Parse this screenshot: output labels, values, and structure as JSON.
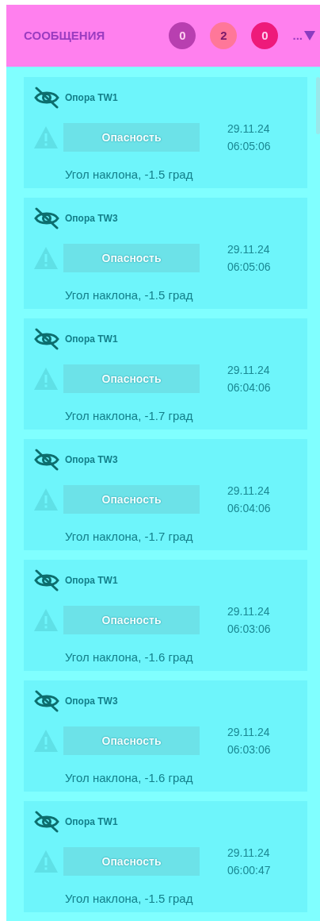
{
  "header": {
    "title": "СООБЩЕНИЯ",
    "counters": [
      {
        "value": "0",
        "color": "#b83fb0"
      },
      {
        "value": "2",
        "color": "#ff7799"
      },
      {
        "value": "0",
        "color": "#ee1a7a"
      }
    ],
    "more": "..."
  },
  "messages": [
    {
      "source": "Опора TW1",
      "severity": "Опасность",
      "date": "29.11.24",
      "time": "06:05:06",
      "text": "Угол наклона, -1.5 град"
    },
    {
      "source": "Опора TW3",
      "severity": "Опасность",
      "date": "29.11.24",
      "time": "06:05:06",
      "text": "Угол наклона, -1.5 град"
    },
    {
      "source": "Опора TW1",
      "severity": "Опасность",
      "date": "29.11.24",
      "time": "06:04:06",
      "text": "Угол наклона, -1.7 град"
    },
    {
      "source": "Опора TW3",
      "severity": "Опасность",
      "date": "29.11.24",
      "time": "06:04:06",
      "text": "Угол наклона, -1.7 град"
    },
    {
      "source": "Опора TW1",
      "severity": "Опасность",
      "date": "29.11.24",
      "time": "06:03:06",
      "text": "Угол наклона, -1.6 град"
    },
    {
      "source": "Опора TW3",
      "severity": "Опасность",
      "date": "29.11.24",
      "time": "06:03:06",
      "text": "Угол наклона, -1.6 град"
    },
    {
      "source": "Опора TW1",
      "severity": "Опасность",
      "date": "29.11.24",
      "time": "06:00:47",
      "text": "Угол наклона, -1.5 град"
    }
  ]
}
